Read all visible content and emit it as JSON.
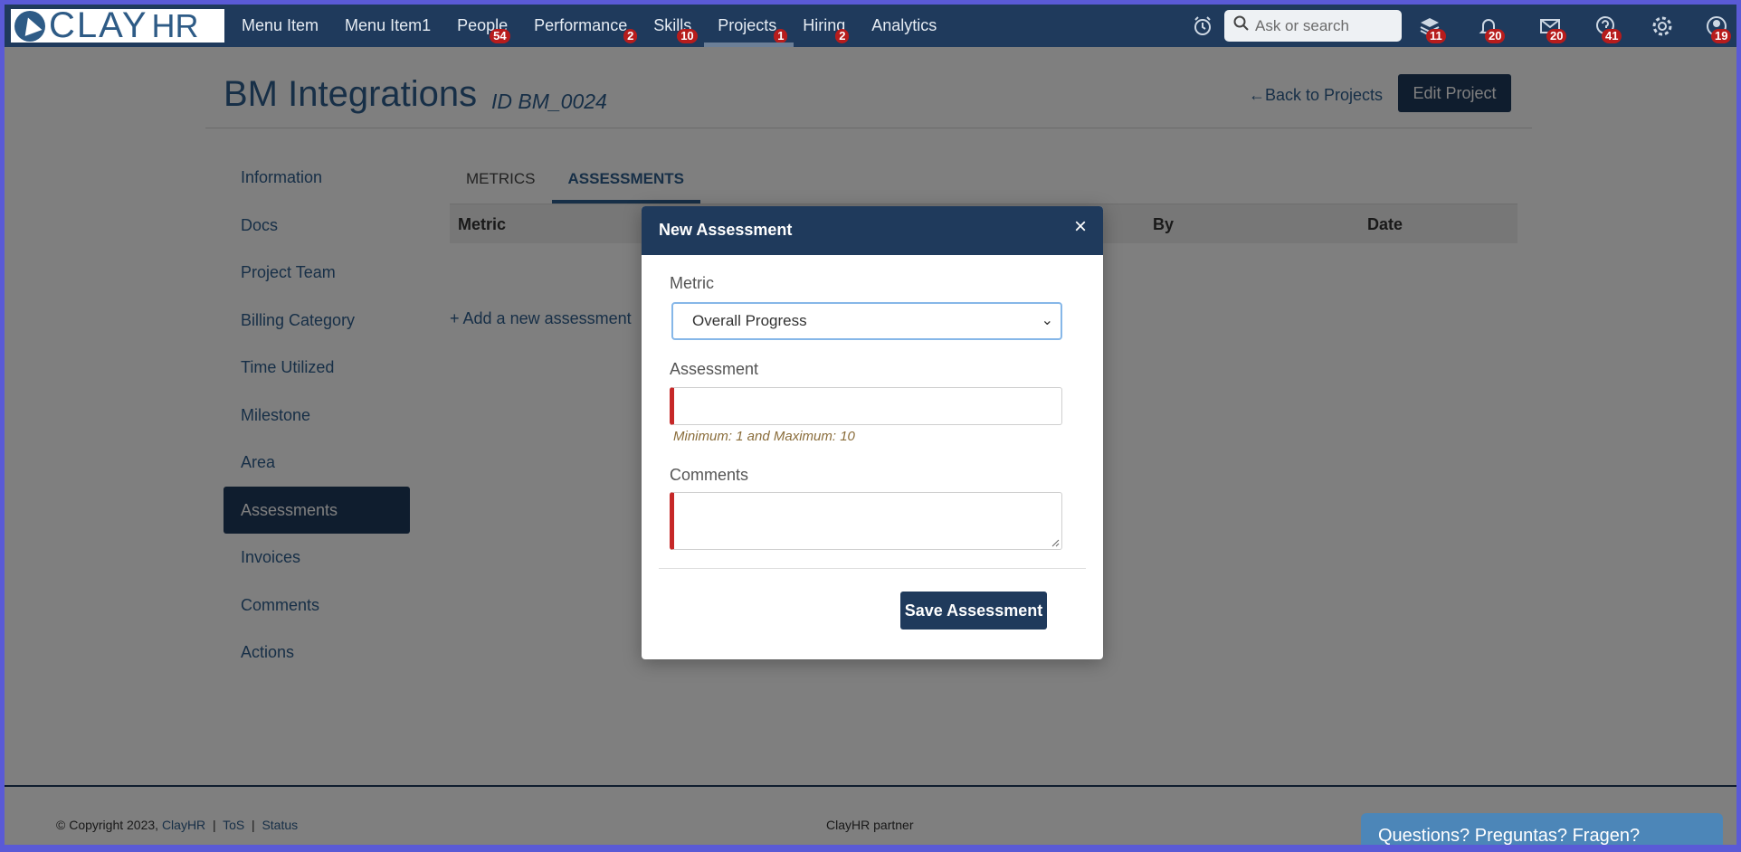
{
  "app": {
    "logo_text": "CLAY",
    "logo_suffix": "HR",
    "nav": [
      {
        "label": "Menu Item",
        "badge": ""
      },
      {
        "label": "Menu Item1",
        "badge": ""
      },
      {
        "label": "People",
        "badge": "54"
      },
      {
        "label": "Performance",
        "badge": "2"
      },
      {
        "label": "Skills",
        "badge": "10"
      },
      {
        "label": "Projects",
        "badge": "1"
      },
      {
        "label": "Hiring",
        "badge": "2"
      },
      {
        "label": "Analytics",
        "badge": ""
      }
    ],
    "search_placeholder": "Ask or search",
    "icon_badges": {
      "courses": "11",
      "notifications": "20",
      "messages": "20",
      "help": "41",
      "profile": "19"
    }
  },
  "page": {
    "title": "BM Integrations",
    "id_label": "ID BM_0024",
    "back_link": "Back to Projects",
    "edit_button": "Edit Project"
  },
  "sidebar": {
    "items": [
      "Information",
      "Docs",
      "Project Team",
      "Billing Category",
      "Time Utilized",
      "Milestone",
      "Area",
      "Assessments",
      "Invoices",
      "Comments",
      "Actions"
    ],
    "active": "Assessments"
  },
  "tabs": {
    "metrics": "METRICS",
    "assessments": "ASSESSMENTS"
  },
  "table": {
    "col_metric": "Metric",
    "col_by": "By",
    "col_date": "Date"
  },
  "add_link": "Add a new assessment",
  "modal": {
    "title": "New Assessment",
    "metric_label": "Metric",
    "metric_value": "Overall Progress",
    "assessment_label": "Assessment",
    "assessment_hint": "Minimum: 1 and Maximum: 10",
    "comments_label": "Comments",
    "save_button": "Save Assessment"
  },
  "footer": {
    "copyright": "© Copyright 2023,",
    "clayhr": "ClayHR",
    "tos": "ToS",
    "status": "Status",
    "sep": "|",
    "partner": "ClayHR partner",
    "help_pill": "Questions? Preguntas? Fragen?"
  }
}
